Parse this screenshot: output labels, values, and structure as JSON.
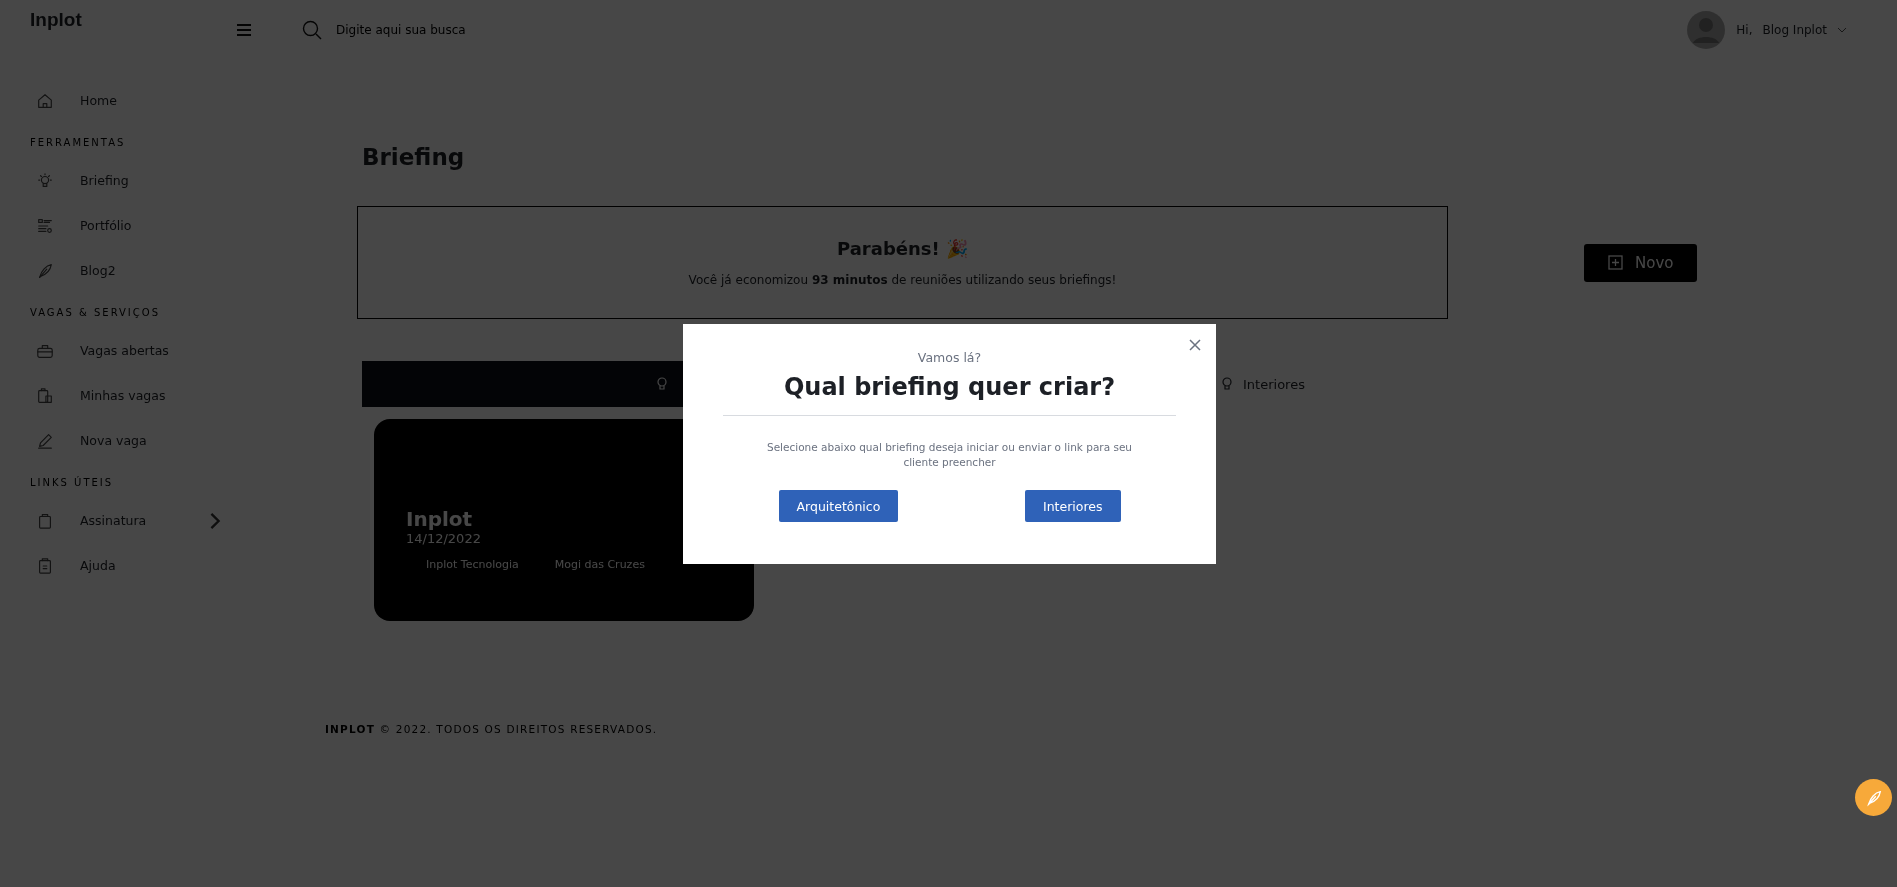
{
  "header": {
    "logo": "Inplot",
    "search": {
      "placeholder": "Digite aqui sua busca"
    },
    "user": {
      "greeting": "Hi,",
      "name": "Blog Inplot"
    }
  },
  "sidebar": {
    "sections": [
      {
        "items": [
          {
            "label": "Home",
            "has_submenu": false
          }
        ]
      },
      {
        "title": "FERRAMENTAS",
        "items": [
          {
            "label": "Briefing",
            "has_submenu": false
          },
          {
            "label": "Portfólio",
            "has_submenu": false
          },
          {
            "label": "Blog2",
            "has_submenu": false
          }
        ]
      },
      {
        "title": "VAGAS & SERVIÇOS",
        "items": [
          {
            "label": "Vagas abertas",
            "has_submenu": false
          },
          {
            "label": "Minhas vagas",
            "has_submenu": false
          },
          {
            "label": "Nova vaga",
            "has_submenu": false
          }
        ]
      },
      {
        "title": "LINKS ÚTEIS",
        "items": [
          {
            "label": "Assinatura",
            "has_submenu": true
          },
          {
            "label": "Ajuda",
            "has_submenu": false
          }
        ]
      }
    ]
  },
  "page": {
    "title": "Briefing",
    "congrats": {
      "title": "Parabéns! 🎉",
      "message": "Você já economizou **93 minutos** de reuniões utilizando seus briefings!"
    },
    "new_button": "Novo",
    "tabs": [
      {
        "selected": true
      },
      {
        "label": "Interiores",
        "selected": false
      }
    ],
    "cards": [
      {
        "title": "Inplot",
        "date": "14/12/2022",
        "company": "Inplot Tecnologia",
        "city": "Mogi das Cruzes"
      }
    ]
  },
  "footer": "**INPLOT** © 2022. TODOS OS DIREITOS RESERVADOS.",
  "modal": {
    "eyebrow": "Vamos lá?",
    "title": "Qual briefing quer criar?",
    "description": "Selecione abaixo qual briefing deseja iniciar ou enviar o link para seu cliente preencher",
    "buttons": [
      "Arquitetônico",
      "Interiores"
    ]
  }
}
